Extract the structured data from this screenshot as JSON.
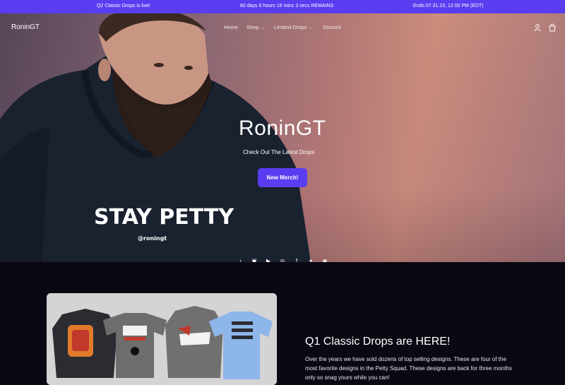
{
  "announcement": {
    "left": "Q2 Classic Drops is live!",
    "center": "60 days 6 hours 16 mins 3 secs REMAINS",
    "right": "Ends 07.31.23, 12:00 PM (EDT)"
  },
  "nav": {
    "logo": "RoninGT",
    "links": [
      "Home",
      "Shop",
      "Limited Drops",
      "Discord"
    ],
    "icons": [
      "account-icon",
      "cart-icon"
    ]
  },
  "hero": {
    "title": "RoninGT",
    "subtitle": "Check Out The Latest Drops",
    "button": "New Merch!",
    "shirt_text": "STAY PETTY",
    "shirt_handle": "@roningt",
    "socials": [
      "tiktok-icon",
      "twitch-icon",
      "youtube-icon",
      "instagram-icon",
      "facebook-icon",
      "twitter-icon",
      "discord-icon"
    ]
  },
  "feature": {
    "title": "Q1 Classic Drops are HERE!",
    "body": "Over the years we have sold dozens of top selling designs. These are four of the most favorite designs in the Petty Squad. These designs are back for three months only so snag yours while you can!"
  },
  "colors": {
    "accent": "#5a3df0",
    "dark_bg": "#0a0812"
  }
}
